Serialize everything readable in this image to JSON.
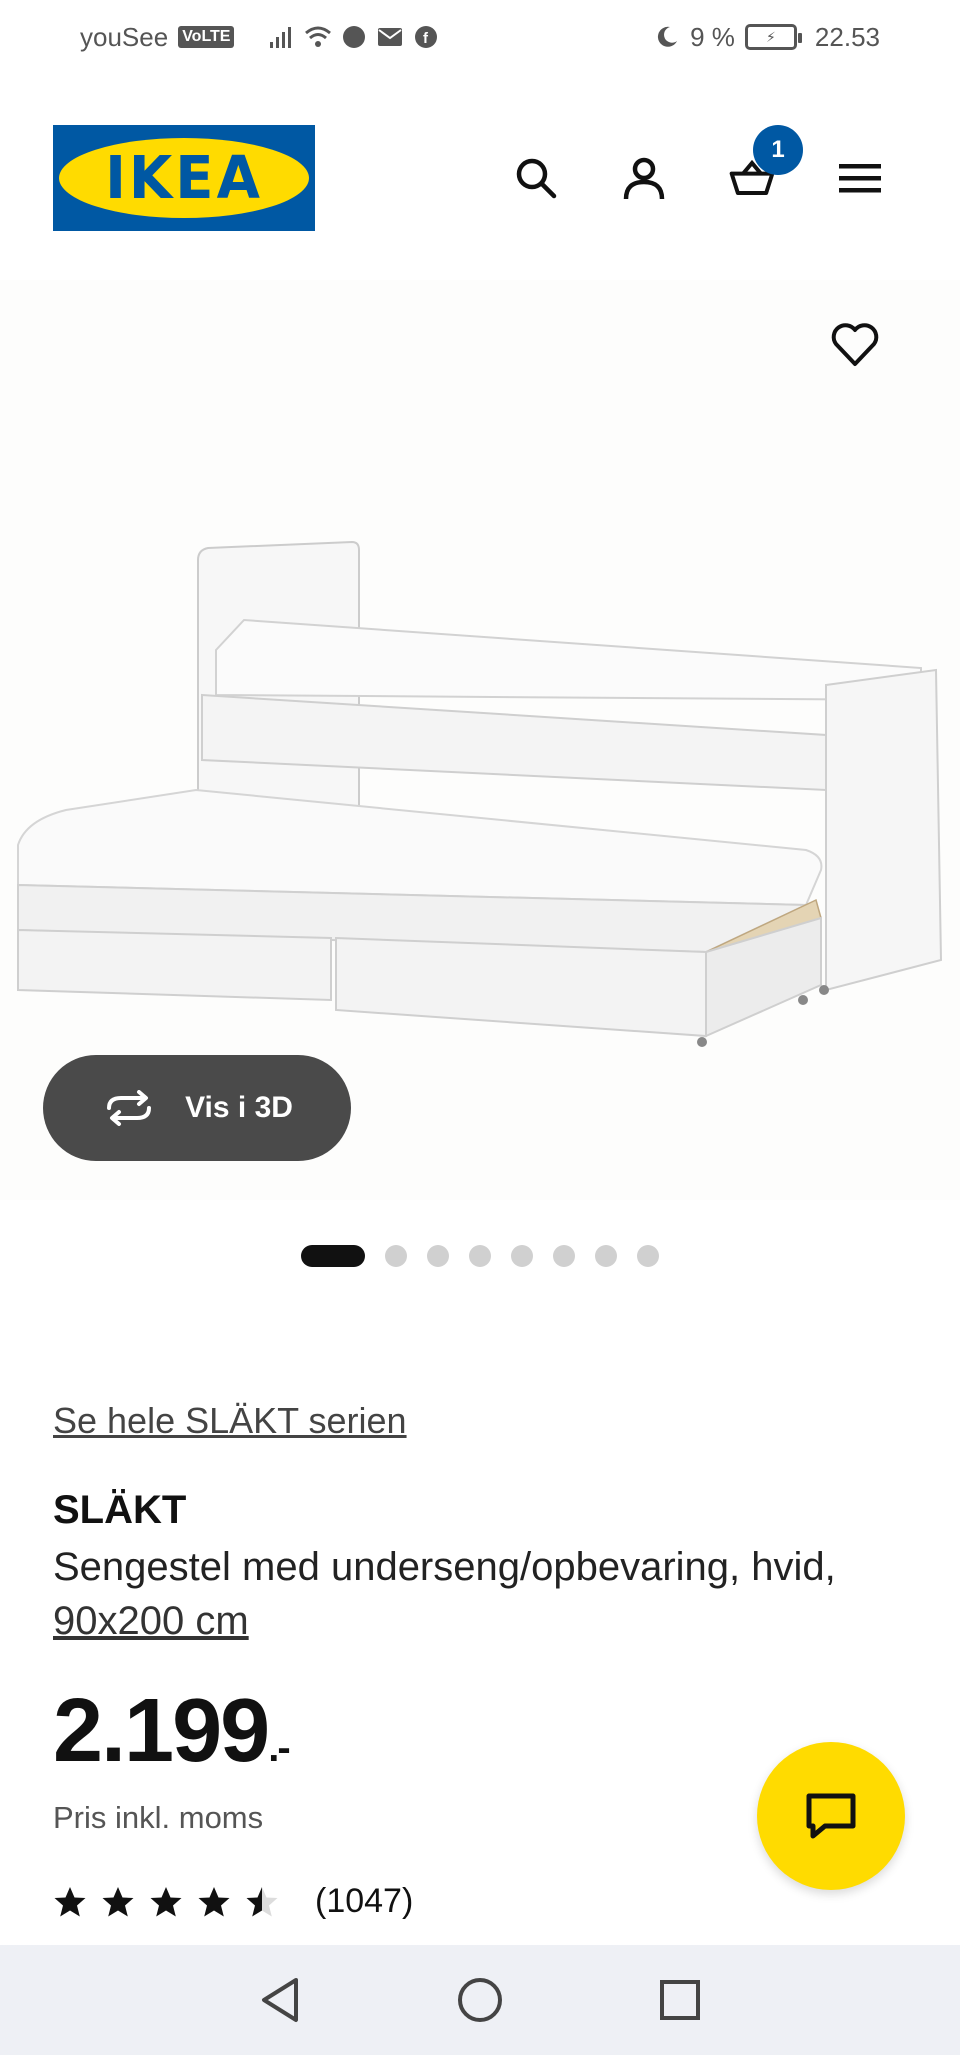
{
  "status_bar": {
    "carrier": "youSee",
    "volte": "VoLTE",
    "battery_percent": "9 %",
    "time": "22.53"
  },
  "header": {
    "logo_text": "IKEA",
    "cart_count": "1",
    "icons": [
      "search-icon",
      "account-icon",
      "cart-icon",
      "menu-icon"
    ]
  },
  "gallery": {
    "view_3d_label": "Vis i 3D",
    "image_count": 8,
    "active_index": 0
  },
  "product": {
    "series_link": "Se hele SLÄKT serien",
    "name": "SLÄKT",
    "description": "Sengestel med underseng/opbevaring, hvid, ",
    "size_link": "90x200 cm",
    "price": "2.199",
    "price_suffix": ".-",
    "vat_note": "Pris inkl. moms",
    "rating_value": 4.5,
    "review_count": "(1047)"
  },
  "colors": {
    "ikea_blue": "#0058a3",
    "ikea_yellow": "#ffdb00"
  }
}
